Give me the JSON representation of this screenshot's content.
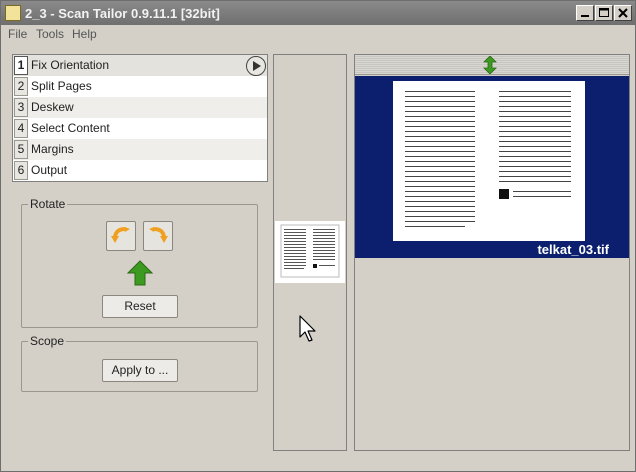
{
  "titlebar": {
    "app_icon_text": "",
    "title": "2_3 - Scan Tailor 0.9.11.1 [32bit]"
  },
  "menu": {
    "items": [
      {
        "label": "File"
      },
      {
        "label": "Tools"
      },
      {
        "label": "Help"
      }
    ]
  },
  "stages": {
    "items": [
      {
        "num": "1",
        "label": "Fix Orientation",
        "selected": true
      },
      {
        "num": "2",
        "label": "Split Pages"
      },
      {
        "num": "3",
        "label": "Deskew"
      },
      {
        "num": "4",
        "label": "Select Content"
      },
      {
        "num": "5",
        "label": "Margins"
      },
      {
        "num": "6",
        "label": "Output"
      }
    ]
  },
  "rotate": {
    "title": "Rotate",
    "reset_label": "Reset"
  },
  "scope": {
    "title": "Scope",
    "apply_label": "Apply to ..."
  },
  "view": {
    "filename": "telkat_03.tif"
  },
  "colors": {
    "view_background": "#0b1f6e",
    "rotate_arrow": "#f0a020",
    "up_arrow": "#3c9a20"
  },
  "icons": {
    "window_minimize": "minimize-icon",
    "window_maximize": "maximize-icon",
    "window_close": "close-icon",
    "play": "play-icon",
    "rotate_left": "rotate-left-icon",
    "rotate_right": "rotate-right-icon",
    "up": "up-arrow-icon",
    "expand": "expand-vertical-icon",
    "cursor": "mouse-cursor-icon"
  }
}
